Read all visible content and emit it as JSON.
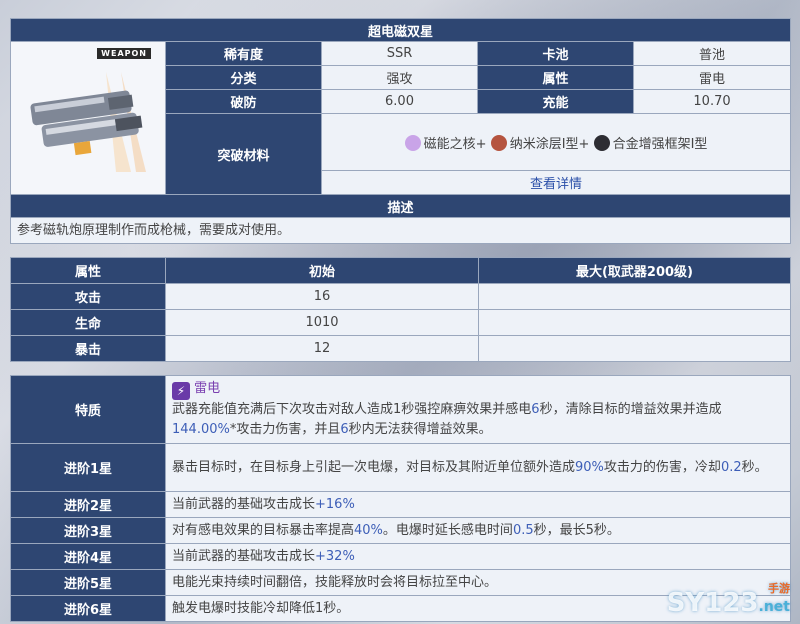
{
  "weapon": {
    "name": "超电磁双星",
    "tag": "WEAPON",
    "stats": [
      {
        "label": "稀有度",
        "value": "SSR",
        "label2": "卡池",
        "value2": "普池"
      },
      {
        "label": "分类",
        "value": "强攻",
        "label2": "属性",
        "value2": "雷电"
      },
      {
        "label": "破防",
        "value": "6.00",
        "label2": "充能",
        "value2": "10.70"
      }
    ],
    "breakthrough": {
      "label": "突破材料",
      "materials": [
        "磁能之核",
        "纳米涂层Ⅰ型",
        "合金增强框架Ⅰ型"
      ],
      "separator": "+",
      "details_link": "查看详情"
    },
    "desc_header": "描述",
    "description": "参考磁轨炮原理制作而成枪械，需要成对使用。"
  },
  "attributes": {
    "headers": [
      "属性",
      "初始",
      "最大(取武器200级)"
    ],
    "rows": [
      {
        "name": "攻击",
        "init": "16",
        "max": ""
      },
      {
        "name": "生命",
        "init": "1010",
        "max": ""
      },
      {
        "name": "暴击",
        "init": "12",
        "max": ""
      }
    ]
  },
  "traits": {
    "trait": {
      "label": "特质",
      "element": "雷电",
      "p1": "武器充能值充满后下次攻击对敌人造成1秒强控麻痹效果并感电",
      "p1_hl": "6",
      "p1_b": "秒，清除目标的增益效果并造成",
      "p1_hl2": "144.00%",
      "p1_c": "*攻击力伤害，并且",
      "p1_hl3": "6",
      "p1_d": "秒内无法获得增益效果。"
    },
    "tiers": [
      {
        "label": "进阶1星",
        "a": "暴击目标时，在目标身上引起一次电爆，对目标及其附近单位额外造成",
        "hl": "90%",
        "b": "攻击力的伤害，冷却",
        "hl2": "0.2",
        "c": "秒。"
      },
      {
        "label": "进阶2星",
        "a": "当前武器的基础攻击成长",
        "hl": "+16%",
        "b": "",
        "hl2": "",
        "c": ""
      },
      {
        "label": "进阶3星",
        "a": "对有感电效果的目标暴击率提高",
        "hl": "40%",
        "b": "。电爆时延长感电时间",
        "hl2": "0.5",
        "c": "秒，最长5秒。"
      },
      {
        "label": "进阶4星",
        "a": "当前武器的基础攻击成长",
        "hl": "+32%",
        "b": "",
        "hl2": "",
        "c": ""
      },
      {
        "label": "进阶5星",
        "a": "电能光束持续时间翻倍，技能释放时会将目标拉至中心。",
        "hl": "",
        "b": "",
        "hl2": "",
        "c": ""
      },
      {
        "label": "进阶6星",
        "a": "触发电爆时技能冷却降低1秒。",
        "hl": "",
        "b": "",
        "hl2": "",
        "c": ""
      }
    ]
  },
  "watermark": {
    "text": "SY123",
    "suffix": ".net",
    "sub": "手游"
  },
  "colors": {
    "header_bg": "#2e4672",
    "cell_bg": "#eef2f8",
    "highlight": "#3d5eb7",
    "element_icon": "#7a3fb0"
  }
}
